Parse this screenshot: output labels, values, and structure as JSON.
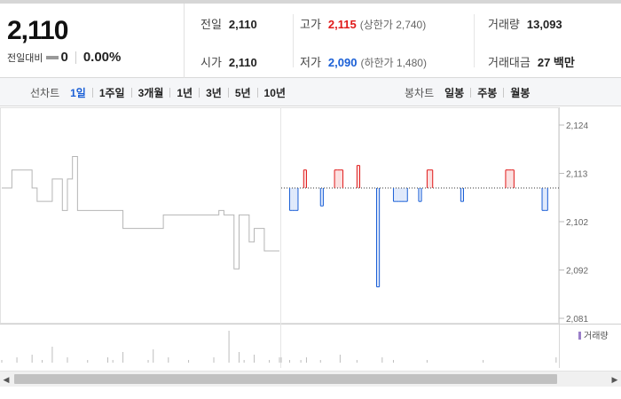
{
  "summary": {
    "current_price": "2,110",
    "change_label": "전일대비",
    "change_value": "0",
    "change_pct": "0.00%",
    "stats": {
      "prev_close": {
        "label": "전일",
        "value": "2,110"
      },
      "high": {
        "label": "고가",
        "value": "2,115",
        "sub": "(상한가 2,740)"
      },
      "volume": {
        "label": "거래량",
        "value": "13,093"
      },
      "open": {
        "label": "시가",
        "value": "2,110"
      },
      "low": {
        "label": "저가",
        "value": "2,090",
        "sub": "(하한가 1,480)"
      },
      "amount": {
        "label": "거래대금",
        "value": "27 백만"
      }
    }
  },
  "toolbar": {
    "line_title": "선차트",
    "line_items": [
      "1일",
      "1주일",
      "3개월",
      "1년",
      "3년",
      "5년",
      "10년"
    ],
    "line_active": "1일",
    "candle_title": "봉차트",
    "candle_items": [
      "일봉",
      "주봉",
      "월봉"
    ]
  },
  "chart_data": {
    "type": "line",
    "y_ticks": [
      "2,124",
      "2,113",
      "2,102",
      "2,092",
      "2,081"
    ],
    "ylim": [
      2081,
      2124
    ],
    "reference": 2110,
    "volume_legend": "거래량",
    "colors": {
      "up": "#e01a1a",
      "down": "#1a5fd6",
      "prev": "#b5b5b5"
    },
    "prev_day": [
      2110,
      2110,
      2114,
      2114,
      2114,
      2114,
      2110,
      2107,
      2107,
      2107,
      2112,
      2112,
      2105,
      2112,
      2117,
      2105,
      2105,
      2105,
      2105,
      2105,
      2105,
      2105,
      2105,
      2105,
      2101,
      2101,
      2101,
      2101,
      2101,
      2101,
      2101,
      2101,
      2104,
      2104,
      2104,
      2104,
      2104,
      2104,
      2104,
      2104,
      2104,
      2104,
      2104,
      2105,
      2104,
      2104,
      2092,
      2104,
      2104,
      2098,
      2101,
      2101,
      2096,
      2096,
      2096,
      2096
    ],
    "today": [
      2110,
      2110,
      2110,
      2105,
      2105,
      2105,
      2110,
      2110,
      2114,
      2110,
      2110,
      2110,
      2110,
      2110,
      2106,
      2110,
      2110,
      2110,
      2110,
      2114,
      2114,
      2114,
      2110,
      2110,
      2110,
      2110,
      2110,
      2115,
      2110,
      2110,
      2110,
      2110,
      2110,
      2110,
      2088,
      2110,
      2110,
      2110,
      2110,
      2110,
      2107,
      2107,
      2107,
      2107,
      2107,
      2110,
      2110,
      2110,
      2110,
      2107,
      2110,
      2110,
      2114,
      2114,
      2110,
      2110,
      2110,
      2110,
      2110,
      2110,
      2110,
      2110,
      2110,
      2110,
      2107,
      2110,
      2110,
      2110,
      2110,
      2110,
      2110,
      2110,
      2110,
      2110,
      2110,
      2110,
      2110,
      2110,
      2110,
      2110,
      2114,
      2114,
      2114,
      2110,
      2110,
      2110,
      2110,
      2110,
      2110,
      2110,
      2110,
      2110,
      2110,
      2105,
      2105,
      2110,
      2110,
      2110,
      2110,
      2110
    ],
    "volume_prev": [
      1,
      0,
      0,
      2,
      0,
      0,
      3,
      0,
      1,
      0,
      6,
      0,
      0,
      2,
      0,
      0,
      0,
      1,
      0,
      0,
      0,
      2,
      1,
      0,
      4,
      0,
      0,
      0,
      0,
      1,
      5,
      0,
      0,
      2,
      0,
      0,
      0,
      1,
      0,
      0,
      0,
      0,
      2,
      0,
      0,
      12,
      0,
      4,
      1,
      0,
      3,
      0,
      0,
      1,
      0,
      2
    ],
    "volume_today": [
      2,
      0,
      0,
      1,
      0,
      0,
      0,
      1,
      0,
      2,
      0,
      0,
      0,
      0,
      1,
      0,
      0,
      0,
      0,
      0,
      0,
      3,
      0,
      0,
      0,
      0,
      0,
      1,
      0,
      0,
      0,
      0,
      0,
      0,
      0,
      0,
      2,
      0,
      0,
      0,
      1,
      0,
      0,
      0,
      0,
      0,
      0,
      0,
      0,
      0,
      0,
      0,
      1,
      0,
      0,
      0,
      0,
      0,
      0,
      0,
      0,
      0,
      0,
      0,
      0,
      0,
      0,
      0,
      0,
      0,
      0,
      0,
      1,
      0,
      0,
      0,
      0,
      0,
      0,
      0,
      0,
      0,
      0,
      0,
      0,
      0,
      0,
      0,
      0,
      0,
      0,
      0,
      0,
      0,
      0,
      0,
      0,
      0,
      2,
      0
    ]
  }
}
